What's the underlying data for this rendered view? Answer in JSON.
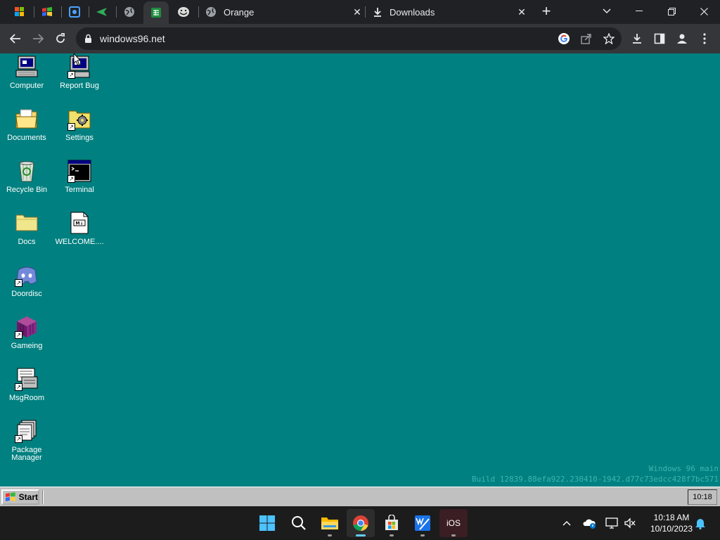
{
  "browser": {
    "tabs": [
      {
        "title": "Orange"
      },
      {
        "title": "Downloads"
      }
    ],
    "address": {
      "url": "windows96.net"
    }
  },
  "desktop": {
    "icons": [
      {
        "label": "Computer",
        "icon": "computer-icon"
      },
      {
        "label": "Report Bug",
        "icon": "report-bug-icon"
      },
      {
        "label": "Documents",
        "icon": "documents-folder-icon"
      },
      {
        "label": "Settings",
        "icon": "settings-folder-icon"
      },
      {
        "label": "Recycle Bin",
        "icon": "recycle-bin-icon"
      },
      {
        "label": "Terminal",
        "icon": "terminal-icon"
      },
      {
        "label": "Docs",
        "icon": "folder-icon"
      },
      {
        "label": "WELCOME....",
        "icon": "markdown-file-icon"
      },
      {
        "label": "Doordisc",
        "icon": "discord-icon"
      },
      {
        "label": "Gameing",
        "icon": "cube-icon"
      },
      {
        "label": "MsgRoom",
        "icon": "msgroom-icon"
      },
      {
        "label": "Package",
        "label2": "Manager",
        "icon": "package-manager-icon"
      }
    ],
    "build": {
      "line1": "Windows 96 main",
      "line2": "Build 12839.88efa922.230410-1942.d77c73edcc428f7bc571"
    }
  },
  "w96_taskbar": {
    "start_label": "Start",
    "tray_time": "10:18"
  },
  "os_taskbar": {
    "clock_time": "10:18 AM",
    "clock_date": "10/10/2023",
    "ios_label": "iOS"
  },
  "colors": {
    "desktop": "#008080",
    "browser_chrome": "#202124",
    "active_accent": "#60cdff"
  }
}
